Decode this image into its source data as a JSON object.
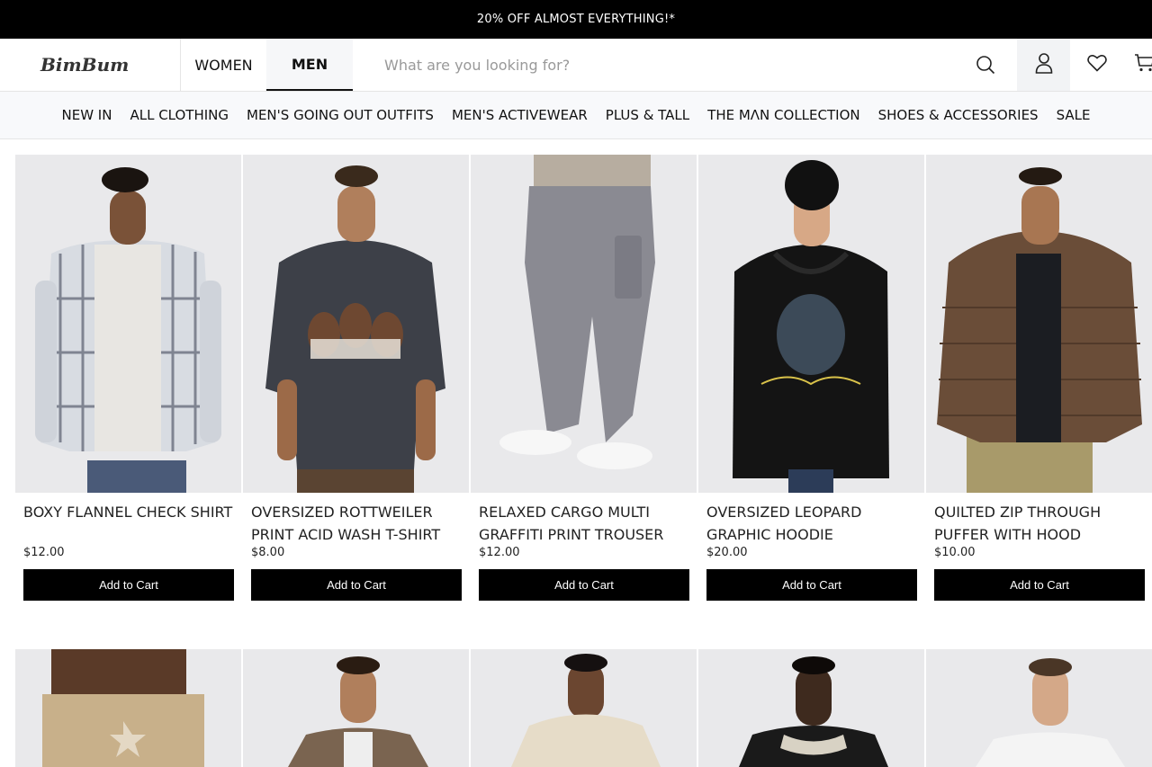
{
  "promo": {
    "text": "20% OFF ALMOST EVERYTHING!*"
  },
  "header": {
    "logo": "BimBum",
    "tabs": [
      {
        "label": "WOMEN",
        "active": false
      },
      {
        "label": "MEN",
        "active": true
      }
    ],
    "search": {
      "placeholder": "What are you looking for?",
      "value": ""
    },
    "icons": [
      "search-icon",
      "account-icon",
      "wishlist-heart-icon",
      "cart-icon"
    ]
  },
  "catnav": {
    "items": [
      "NEW IN",
      "ALL CLOTHING",
      "MEN'S GOING OUT OUTFITS",
      "MEN'S ACTIVEWEAR",
      "PLUS & TALL",
      "THE MΛN COLLECTION",
      "SHOES & ACCESSORIES",
      "SALE"
    ]
  },
  "products": [
    {
      "title": "BOXY FLANNEL CHECK SHIRT",
      "price": "$12.00",
      "button": "Add to Cart"
    },
    {
      "title": "OVERSIZED ROTTWEILER PRINT ACID WASH T-SHIRT",
      "price": "$8.00",
      "button": "Add to Cart"
    },
    {
      "title": "RELAXED CARGO MULTI GRAFFITI PRINT TROUSER",
      "price": "$12.00",
      "button": "Add to Cart"
    },
    {
      "title": "OVERSIZED LEOPARD GRAPHIC HOODIE",
      "price": "$20.00",
      "button": "Add to Cart"
    },
    {
      "title": "QUILTED ZIP THROUGH PUFFER WITH HOOD",
      "price": "$10.00",
      "button": "Add to Cart"
    }
  ],
  "colors": {
    "accent": "#000000",
    "nav_bg": "#f8f9fb",
    "image_bg": "#e9e9eb"
  }
}
